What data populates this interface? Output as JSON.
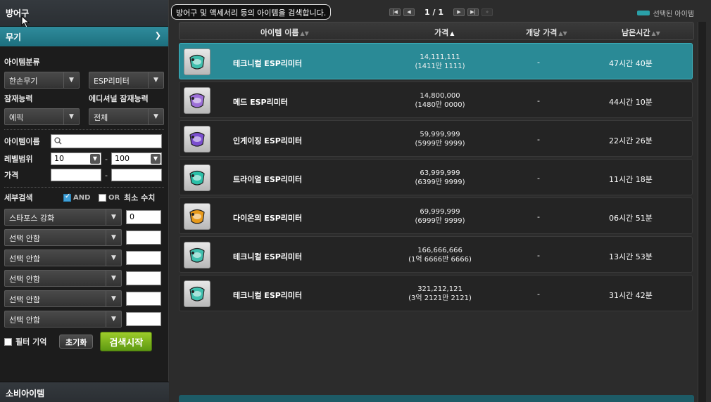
{
  "sidebar": {
    "category_title": "방어구",
    "sub_title": "무기",
    "item_class_label": "아이템분류",
    "item_class_main": "한손무기",
    "item_class_sub": "ESP리미터",
    "potential_label": "잠재능력",
    "additional_potential_label": "에디셔널 잠재능력",
    "potential_value": "에픽",
    "additional_potential_value": "전체",
    "item_name_label": "아이템이름",
    "item_name_value": "",
    "level_label": "레벨범위",
    "level_min": "10",
    "level_max": "100",
    "level_sep": "-",
    "price_label": "가격",
    "price_min": "",
    "price_max": "",
    "price_sep": "-",
    "detail_label": "세부검색",
    "and_label": "AND",
    "or_label": "OR",
    "min_value_label": "최소 수치",
    "detail_rows": [
      {
        "option": "스타포스 강화",
        "value": "0"
      },
      {
        "option": "선택 안함",
        "value": ""
      },
      {
        "option": "선택 안함",
        "value": ""
      },
      {
        "option": "선택 안함",
        "value": ""
      },
      {
        "option": "선택 안함",
        "value": ""
      },
      {
        "option": "선택 안함",
        "value": ""
      }
    ],
    "filter_memory_label": "필터 기억",
    "reset_label": "초기화",
    "search_label": "검색시작",
    "consumable_title": "소비아이템"
  },
  "topbar": {
    "tooltip": "방어구 및 액세서리 등의 아이템을 검색합니다.",
    "page": "1 / 1",
    "legend": "선택된 아이템"
  },
  "table": {
    "headers": {
      "name": "아이템 이름",
      "price": "가격",
      "unit_price": "개당 가격",
      "remaining": "남은시간"
    },
    "rows": [
      {
        "name": "테크니컬 ESP리미터",
        "price": "14,111,111",
        "price_kr": "(1411만 1111)",
        "unit": "-",
        "time": "47시간 40분",
        "selected": true,
        "icon_color": "#3fbfae"
      },
      {
        "name": "메드 ESP리미터",
        "price": "14,800,000",
        "price_kr": "(1480만 0000)",
        "unit": "-",
        "time": "44시간 10분",
        "selected": false,
        "icon_color": "#9c6fd8"
      },
      {
        "name": "인게이징 ESP리미터",
        "price": "59,999,999",
        "price_kr": "(5999만 9999)",
        "unit": "-",
        "time": "22시간 26분",
        "selected": false,
        "icon_color": "#7b4fd0"
      },
      {
        "name": "트라이얼 ESP리미터",
        "price": "63,999,999",
        "price_kr": "(6399만 9999)",
        "unit": "-",
        "time": "11시간 18분",
        "selected": false,
        "icon_color": "#2bc0a8"
      },
      {
        "name": "다이온의 ESP리미터",
        "price": "69,999,999",
        "price_kr": "(6999만 9999)",
        "unit": "-",
        "time": "06시간 51분",
        "selected": false,
        "icon_color": "#e89a1a"
      },
      {
        "name": "테크니컬 ESP리미터",
        "price": "166,666,666",
        "price_kr": "(1억 6666만 6666)",
        "unit": "-",
        "time": "13시간 53분",
        "selected": false,
        "icon_color": "#3fbfae"
      },
      {
        "name": "테크니컬 ESP리미터",
        "price": "321,212,121",
        "price_kr": "(3억 2121만 2121)",
        "unit": "-",
        "time": "31시간 42분",
        "selected": false,
        "icon_color": "#3fbfae"
      }
    ]
  },
  "colors": {
    "selected_row": "#2a8a96",
    "search_button": "#7db21e",
    "sub_header": "#2a8090"
  }
}
